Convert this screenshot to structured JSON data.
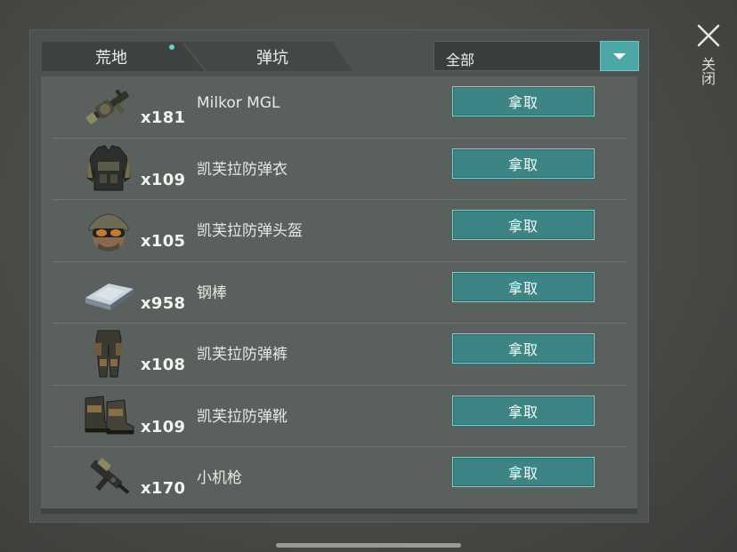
{
  "tabs": [
    {
      "label": "荒地",
      "active": true,
      "has_notification": true
    },
    {
      "label": "弹坑",
      "active": false
    }
  ],
  "filter": {
    "selected": "全部"
  },
  "close_label": "关闭",
  "take_label": "拿取",
  "items": [
    {
      "name": "Milkor MGL",
      "quantity": "x181",
      "icon": "grenade-launcher-icon"
    },
    {
      "name": "凯芙拉防弹衣",
      "quantity": "x109",
      "icon": "kevlar-vest-icon"
    },
    {
      "name": "凯芙拉防弹头盔",
      "quantity": "x105",
      "icon": "kevlar-helmet-icon"
    },
    {
      "name": "钢棒",
      "quantity": "x958",
      "icon": "steel-bar-icon"
    },
    {
      "name": "凯芙拉防弹裤",
      "quantity": "x108",
      "icon": "kevlar-pants-icon"
    },
    {
      "name": "凯芙拉防弹靴",
      "quantity": "x109",
      "icon": "kevlar-boots-icon"
    },
    {
      "name": "小机枪",
      "quantity": "x170",
      "icon": "smg-icon"
    }
  ],
  "colors": {
    "accent": "#4aa9a6",
    "button": "#3d8584",
    "button_border": "#7cd2cd",
    "notification_dot": "#62d3c6"
  }
}
